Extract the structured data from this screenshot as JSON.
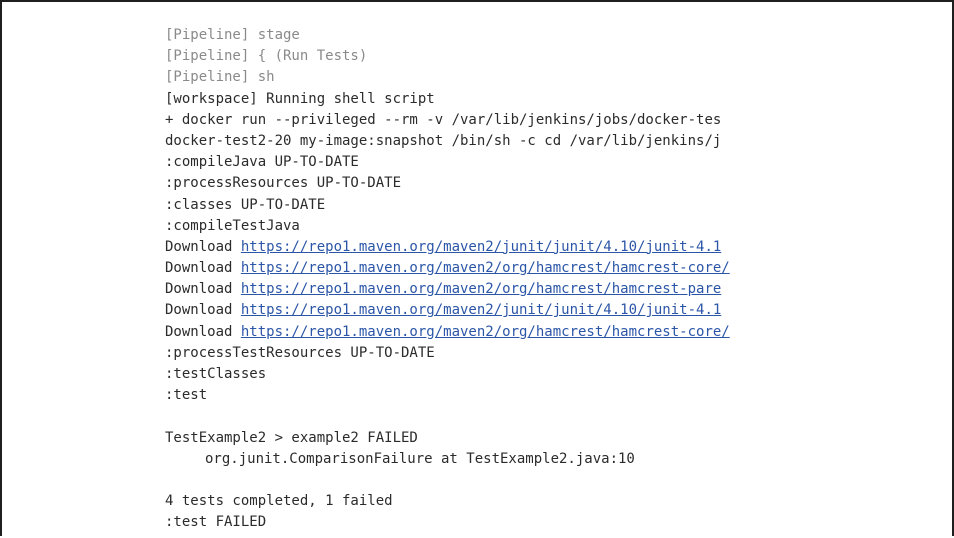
{
  "console": {
    "lines": [
      {
        "type": "muted",
        "text": "[Pipeline] stage"
      },
      {
        "type": "muted",
        "text": "[Pipeline] { (Run Tests)"
      },
      {
        "type": "muted",
        "text": "[Pipeline] sh"
      },
      {
        "type": "text",
        "text": "[workspace] Running shell script"
      },
      {
        "type": "text",
        "text": "+ docker run --privileged --rm -v /var/lib/jenkins/jobs/docker-tes"
      },
      {
        "type": "text",
        "text": "docker-test2-20 my-image:snapshot /bin/sh -c cd /var/lib/jenkins/j"
      },
      {
        "type": "text",
        "text": ":compileJava UP-TO-DATE"
      },
      {
        "type": "text",
        "text": ":processResources UP-TO-DATE"
      },
      {
        "type": "text",
        "text": ":classes UP-TO-DATE"
      },
      {
        "type": "text",
        "text": ":compileTestJava"
      },
      {
        "type": "download",
        "label": "Download ",
        "url": "https://repo1.maven.org/maven2/junit/junit/4.10/junit-4.1"
      },
      {
        "type": "download",
        "label": "Download ",
        "url": "https://repo1.maven.org/maven2/org/hamcrest/hamcrest-core/"
      },
      {
        "type": "download",
        "label": "Download ",
        "url": "https://repo1.maven.org/maven2/org/hamcrest/hamcrest-pare"
      },
      {
        "type": "download",
        "label": "Download ",
        "url": "https://repo1.maven.org/maven2/junit/junit/4.10/junit-4.1"
      },
      {
        "type": "download",
        "label": "Download ",
        "url": "https://repo1.maven.org/maven2/org/hamcrest/hamcrest-core/"
      },
      {
        "type": "text",
        "text": ":processTestResources UP-TO-DATE"
      },
      {
        "type": "text",
        "text": ":testClasses"
      },
      {
        "type": "text",
        "text": ":test"
      },
      {
        "type": "blank",
        "text": ""
      },
      {
        "type": "text",
        "text": "TestExample2 > example2 FAILED"
      },
      {
        "type": "indent",
        "text": "org.junit.ComparisonFailure at TestExample2.java:10"
      },
      {
        "type": "blank",
        "text": ""
      },
      {
        "type": "text",
        "text": "4 tests completed, 1 failed"
      },
      {
        "type": "text",
        "text": ":test FAILED"
      }
    ]
  },
  "colors": {
    "text": "#2b2b2b",
    "muted": "#8a8a8a",
    "link": "#2b56a8",
    "border": "#1f1f1f",
    "background": "#ffffff"
  }
}
